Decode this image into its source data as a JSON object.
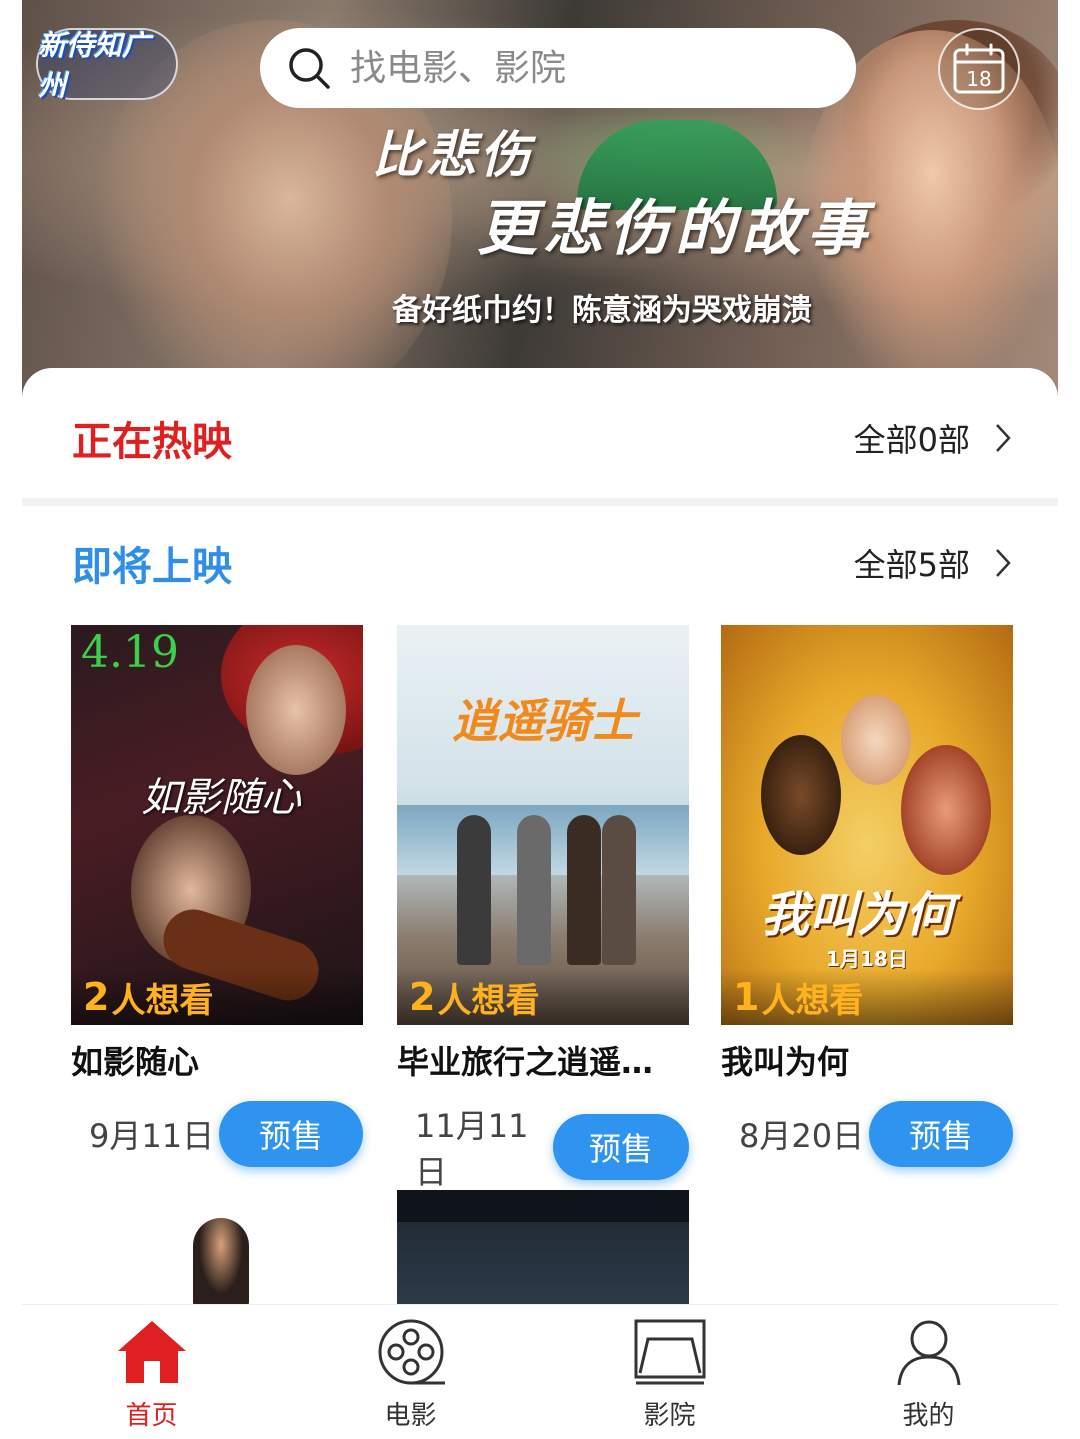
{
  "banner": {
    "logo_text": "新侍知广州",
    "headline_line1": "比悲伤",
    "headline_line2": "更悲伤的故事",
    "subhead": "备好纸巾约！陈意涵为哭戏崩溃"
  },
  "search": {
    "placeholder": "找电影、影院"
  },
  "calendar": {
    "day": "18",
    "icon": "calendar-icon"
  },
  "now_showing": {
    "title": "正在热映",
    "all_label": "全部0部",
    "title_color": "#e02020"
  },
  "coming_soon": {
    "title": "即将上映",
    "all_label": "全部5部",
    "title_color": "#2f8fe8",
    "movies": [
      {
        "title": "如影随心",
        "want_count": "2",
        "want_suffix": "人想看",
        "date": "9月11日",
        "action": "预售",
        "poster_date": "4.19",
        "poster_title": "如影随心"
      },
      {
        "title": "毕业旅行之逍遥…",
        "want_count": "2",
        "want_suffix": "人想看",
        "date": "11月11日",
        "action": "预售",
        "poster_title": "逍遥骑士"
      },
      {
        "title": "我叫为何",
        "want_count": "1",
        "want_suffix": "人想看",
        "date": "8月20日",
        "action": "预售",
        "poster_title": "我叫为何",
        "poster_date": "1月18日"
      }
    ]
  },
  "tabbar": {
    "items": [
      {
        "label": "首页",
        "icon": "home-icon",
        "active": true
      },
      {
        "label": "电影",
        "icon": "film-reel-icon",
        "active": false
      },
      {
        "label": "影院",
        "icon": "cinema-screen-icon",
        "active": false
      },
      {
        "label": "我的",
        "icon": "user-icon",
        "active": false
      }
    ]
  },
  "colors": {
    "accent_blue": "#2f93f0",
    "accent_red": "#e02020",
    "want_orange": "#ffb21e"
  }
}
